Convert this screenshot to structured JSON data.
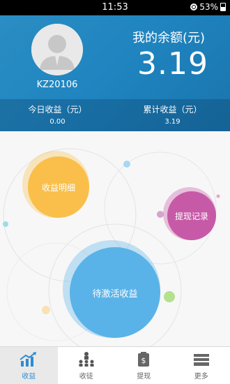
{
  "status_bar": {
    "time": "11:53",
    "battery": "53%"
  },
  "account": {
    "username": "KZ20106",
    "balance_label": "我的余额(元)",
    "balance_value": "3.19",
    "today_label": "今日收益（元）",
    "today_value": "0.00",
    "total_label": "累计收益（元）",
    "total_value": "3.19"
  },
  "bubbles": {
    "detail": "收益明细",
    "withdraw_record": "提现记录",
    "pending": "待激活收益"
  },
  "colors": {
    "header": "#1f84bf",
    "detail": "#f9bf4a",
    "withdraw": "#c75aa7",
    "pending": "#5ab3e8",
    "active_tab": "#2e8ad2"
  },
  "tabs": [
    {
      "label": "收益",
      "icon": "income-chart-icon",
      "active": true
    },
    {
      "label": "收徒",
      "icon": "apprentice-tree-icon",
      "active": false
    },
    {
      "label": "提现",
      "icon": "money-bag-icon",
      "active": false
    },
    {
      "label": "更多",
      "icon": "stack-icon",
      "active": false
    }
  ]
}
